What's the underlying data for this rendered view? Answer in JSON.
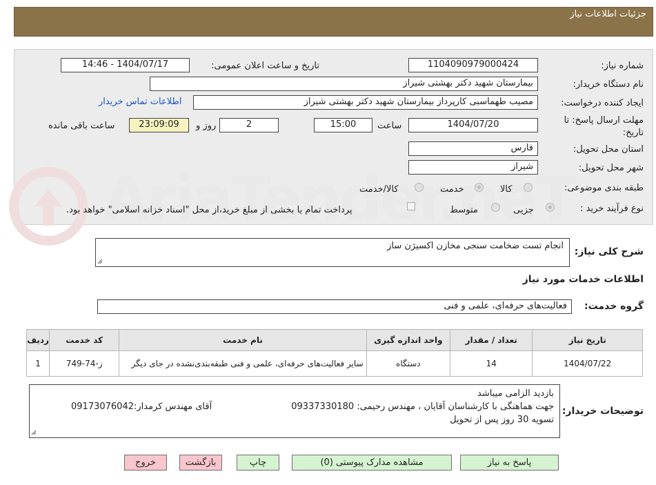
{
  "header": {
    "title": "جزئیات اطلاعات نیاز"
  },
  "watermark": {
    "text": "AriaTender.neT"
  },
  "form": {
    "need_number_label": "شماره نیاز:",
    "need_number": "1104090979000424",
    "announce_label": "تاریخ و ساعت اعلان عمومی:",
    "announce_value": "1404/07/17 - 14:46",
    "buyer_org_label": "نام دستگاه خریدار:",
    "buyer_org": "بیمارستان شهید دکتر بهشتی شیراز",
    "requester_label": "ایجاد کننده درخواست:",
    "requester": "مصیب طهماسبی کارپرداز بیمارستان شهید دکتر بهشتی شیراز",
    "contact_link": "اطلاعات تماس خریدار",
    "deadline_label": "مهلت ارسال پاسخ: تا تاریخ:",
    "deadline_date": "1404/07/20",
    "time_label": "ساعت",
    "deadline_time": "15:00",
    "days_value": "2",
    "days_label": "روز و",
    "remaining_time": "23:09:09",
    "remaining_label": "ساعت باقی مانده",
    "province_label": "استان محل تحویل:",
    "province": "فارس",
    "city_label": "شهر محل تحویل:",
    "city": "شیراز",
    "category_label": "طبقه بندی موضوعی:",
    "category_options": [
      "کالا",
      "خدمت",
      "کالا/خدمت"
    ],
    "process_label": "نوع فرآیند خرید :",
    "process_options": [
      "جزیی",
      "متوسط"
    ],
    "payment_note": "پرداخت تمام یا بخشی از مبلغ خرید،از محل \"اسناد خزانه اسلامی\" خواهد بود."
  },
  "summary": {
    "label": "شرح کلی نیاز:",
    "text": "انجام تست ضخامت سنجی مخازن اکسیژن ساز"
  },
  "services": {
    "title": "اطلاعات خدمات مورد نیاز",
    "group_label": "گروه خدمت:",
    "group_value": "فعالیت‌های حرفه‌ای، علمی و فنی",
    "columns": [
      "ردیف",
      "کد خدمت",
      "نام خدمت",
      "واحد اندازه گیری",
      "تعداد / مقدار",
      "تاریخ نیاز"
    ],
    "rows": [
      [
        "1",
        "ز-74-749",
        "سایر فعالیت‌های حرفه‌ای، علمی و فنی طبقه‌بندی‌نشده در جای دیگر",
        "دستگاه",
        "14",
        "1404/07/22"
      ]
    ]
  },
  "buyer_notes": {
    "label": "توضیحات خریدار:",
    "line1": "بازدید الزامی میباشد",
    "line2_right": "جهت هماهنگی با کارشناسان آقایان ، مهندس رحیمی: 09337330180",
    "line2_left": "آقای مهندس کرمدار:09173076042",
    "line3": "تسویه 30 روز پس از تحویل"
  },
  "buttons": {
    "reply": "پاسخ به نیاز",
    "attachments": "مشاهده مدارک پیوستی (0)",
    "print": "چاپ",
    "back": "بازگشت",
    "exit": "خروج"
  },
  "colors": {
    "header_bg": "#8B7349",
    "panel_bg": "#ececec",
    "link": "#1a55c9",
    "green_button": "#d6f3d1",
    "red_button": "#f8c6cc",
    "yellow_field": "#f6f3c0"
  }
}
